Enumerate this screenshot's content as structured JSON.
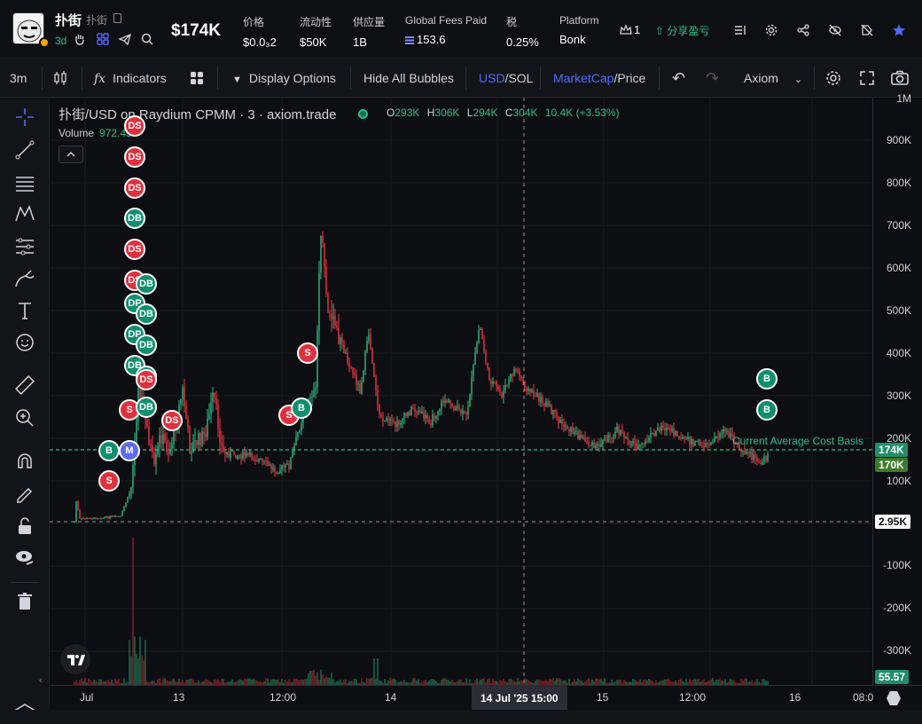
{
  "header": {
    "token_name": "扑街",
    "token_sub": "扑街",
    "age": "3d",
    "market_cap": "$174K",
    "stats": [
      {
        "label": "价格",
        "value": "$0.0₃2"
      },
      {
        "label": "流动性",
        "value": "$50K"
      },
      {
        "label": "供应量",
        "value": "1B"
      },
      {
        "label": "Global Fees Paid",
        "value": "153.6"
      },
      {
        "label": "税",
        "value": "0.25%"
      },
      {
        "label": "Platform",
        "value": "Bonk"
      }
    ],
    "crown_count": "1",
    "pnl_label": "分享盈亏"
  },
  "toolbar": {
    "interval": "3m",
    "indicators": "Indicators",
    "display_options": "Display Options",
    "hide_bubbles": "Hide All Bubbles",
    "usd": "USD",
    "sol": "/SOL",
    "marketcap": "MarketCap",
    "price": "/Price",
    "source": "Axiom"
  },
  "chart": {
    "title": "扑街/USD on Raydium CPMM · 3 · axiom.trade",
    "ohlc": [
      {
        "k": "O",
        "v": "293K"
      },
      {
        "k": "H",
        "v": "306K"
      },
      {
        "k": "L",
        "v": "294K"
      },
      {
        "k": "C",
        "v": "304K"
      }
    ],
    "change": "10.4K (+3.53%)",
    "volume_label": "Volume",
    "volume_value": "972.43",
    "avg_cost_label": "Current Average Cost Basis",
    "y_ticks": [
      "1M",
      "900K",
      "800K",
      "700K",
      "600K",
      "500K",
      "400K",
      "300K",
      "200K",
      "100K",
      "-100K",
      "-200K",
      "-300K"
    ],
    "y_tags": {
      "price": "174K",
      "avg": "170K",
      "cross": "2.95K",
      "volume": "55.57"
    },
    "x_ticks": [
      "Jul",
      "13",
      "12:00",
      "14",
      "15",
      "12:00",
      "16",
      "08:0"
    ],
    "x_cross": "14 Jul '25   15:00",
    "colors": {
      "up": "#2ebd85",
      "down": "#f23645",
      "accent": "#4f6bff"
    }
  },
  "bubbles": [
    {
      "t": "DS",
      "c": "s"
    },
    {
      "t": "DS",
      "c": "s"
    },
    {
      "t": "DS",
      "c": "s"
    },
    {
      "t": "DB",
      "c": "b"
    },
    {
      "t": "DS",
      "c": "s"
    },
    {
      "t": "DS",
      "c": "s"
    },
    {
      "t": "DB",
      "c": "b"
    },
    {
      "t": "DP",
      "c": "b"
    },
    {
      "t": "DB",
      "c": "b"
    },
    {
      "t": "DP",
      "c": "b"
    },
    {
      "t": "DB",
      "c": "b"
    },
    {
      "t": "DB",
      "c": "b"
    },
    {
      "t": "DP",
      "c": "b"
    },
    {
      "t": "DS",
      "c": "s"
    },
    {
      "t": "S",
      "c": "s"
    },
    {
      "t": "DB",
      "c": "b"
    },
    {
      "t": "DS",
      "c": "s"
    },
    {
      "t": "B",
      "c": "b"
    },
    {
      "t": "M",
      "c": "m"
    },
    {
      "t": "S",
      "c": "s"
    },
    {
      "t": "S",
      "c": "s"
    },
    {
      "t": "S",
      "c": "s"
    },
    {
      "t": "B",
      "c": "b"
    },
    {
      "t": "B",
      "c": "b"
    },
    {
      "t": "B",
      "c": "b"
    }
  ]
}
